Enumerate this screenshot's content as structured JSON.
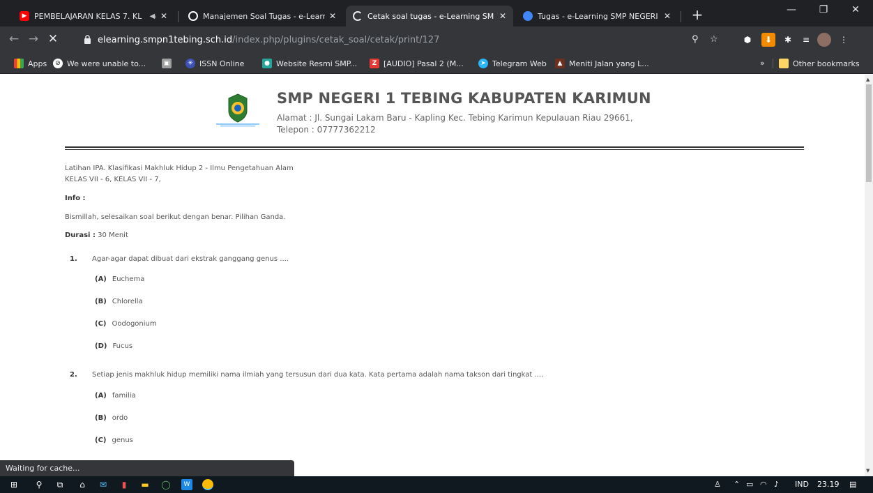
{
  "browser": {
    "tabs": [
      {
        "title": "PEMBELAJARAN KELAS 7. KL",
        "favicon": "youtube-icon",
        "color": "#ff0000",
        "audio": true
      },
      {
        "title": "Manajemen Soal Tugas - e-Learn",
        "favicon": "elearning-icon",
        "color": "#ffffff"
      },
      {
        "title": "Cetak soal tugas - e-Learning SM",
        "favicon": "loading-icon",
        "color": "#e8eaed",
        "active": true
      },
      {
        "title": "Tugas - e-Learning SMP NEGERI",
        "favicon": "elearning-icon",
        "color": "#4285f4"
      }
    ],
    "url_host": "elearning.smpn1tebing.sch.id",
    "url_path": "/index.php/plugins/cetak_soal/cetak/print/127",
    "bookmarks": [
      {
        "label": "Apps",
        "icon": "apps-grid-icon"
      },
      {
        "label": "We were unable to...",
        "icon": "wp-icon"
      },
      {
        "label": "",
        "icon": "portrait-icon"
      },
      {
        "label": "ISSN Online",
        "icon": "issn-icon"
      },
      {
        "label": "Website Resmi SMP...",
        "icon": "school-site-icon"
      },
      {
        "label": "[AUDIO] Pasal 2 (M...",
        "icon": "z-icon"
      },
      {
        "label": "Telegram Web",
        "icon": "telegram-icon"
      },
      {
        "label": "Meniti Jalan yang L...",
        "icon": "mountain-icon"
      }
    ],
    "overflow": "»",
    "other_bookmarks": "Other bookmarks",
    "status": "Waiting for cache..."
  },
  "school": {
    "name": "SMP NEGERI 1 TEBING KABUPATEN KARIMUN",
    "address": "Alamat : Jl. Sungai Lakam Baru - Kapling Kec. Tebing Karimun Kepulauan Riau 29661,",
    "phone": "Telepon : 07777362212"
  },
  "exam": {
    "title": "Latihan IPA. Klasifikasi Makhluk Hidup 2 - Ilmu Pengetahuan Alam",
    "classes": "KELAS VII - 6, KELAS VII - 7,",
    "info_label": "Info :",
    "info_text": "Bismillah, selesaikan soal berikut dengan benar. Pilihan  Ganda.",
    "duration_label": "Durasi :",
    "duration_value": "30 Menit",
    "questions": [
      {
        "num": "1.",
        "text": "Agar-agar dapat dibuat dari ekstrak ganggang genus ....",
        "options": [
          {
            "letter": "(A)",
            "text": "Euchema"
          },
          {
            "letter": "(B)",
            "text": "Chlorella"
          },
          {
            "letter": "(C)",
            "text": "Oodogonium"
          },
          {
            "letter": "(D)",
            "text": "Fucus"
          }
        ]
      },
      {
        "num": "2.",
        "text": "Setiap jenis makhluk hidup memiliki nama ilmiah yang tersusun dari dua kata. Kata pertama adalah nama takson dari tingkat ....",
        "options": [
          {
            "letter": "(A)",
            "text": "familia"
          },
          {
            "letter": "(B)",
            "text": "ordo"
          },
          {
            "letter": "(C)",
            "text": "genus"
          }
        ]
      }
    ]
  },
  "taskbar": {
    "lang": "IND",
    "time": "23.19"
  }
}
